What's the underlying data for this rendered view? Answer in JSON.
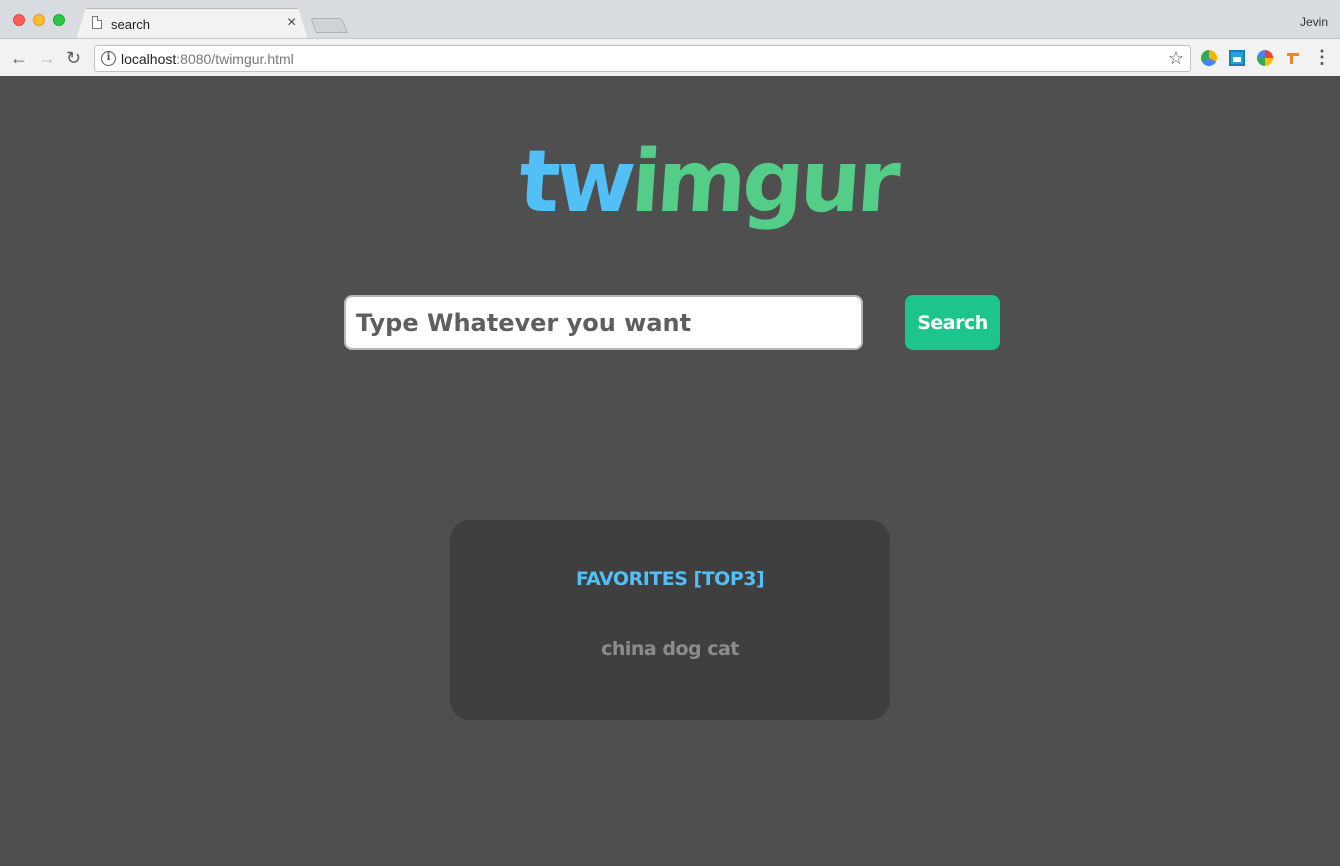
{
  "browser": {
    "tab_title": "search",
    "tab_close": "×",
    "profile_name": "Jevin",
    "url_host": "localhost",
    "url_rest": ":8080/twimgur.html",
    "icons": {
      "back": "back-arrow-icon",
      "forward": "forward-arrow-icon",
      "reload": "reload-icon",
      "info": "info-icon",
      "bookmark": "star-icon",
      "menu": "more-vert-icon"
    }
  },
  "app": {
    "logo_part1": "tw",
    "logo_part2": "imgur",
    "search": {
      "placeholder": "Type Whatever you want",
      "value": "",
      "button_label": "Search"
    },
    "favorites": {
      "title": "FAVORITES [TOP3]",
      "items": "china dog cat"
    }
  },
  "colors": {
    "background": "#4f4f4f",
    "panel": "#3f3f3f",
    "blue_accent": "#52bff6",
    "green_accent": "#53cd87",
    "button": "#1dc58d"
  }
}
